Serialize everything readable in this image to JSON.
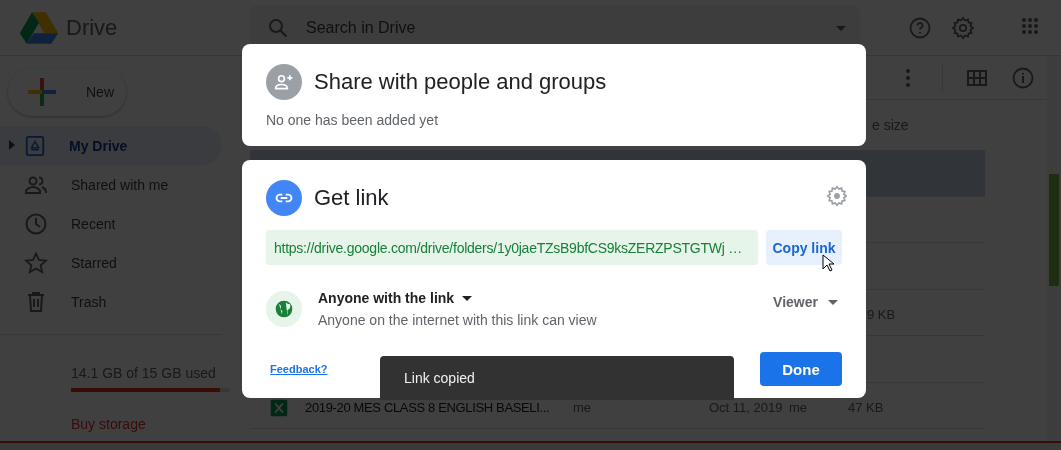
{
  "app": {
    "name": "Drive"
  },
  "search": {
    "placeholder": "Search in Drive"
  },
  "new_button": {
    "label": "New"
  },
  "sidebar": {
    "items": [
      {
        "kind": "my-drive",
        "label": "My Drive",
        "selected": true,
        "expanded": false
      },
      {
        "kind": "shared",
        "label": "Shared with me",
        "selected": false
      },
      {
        "kind": "recent",
        "label": "Recent",
        "selected": false
      },
      {
        "kind": "starred",
        "label": "Starred",
        "selected": false
      },
      {
        "kind": "trash",
        "label": "Trash",
        "selected": false
      }
    ]
  },
  "storage": {
    "usage": "14.1 GB of 15 GB used",
    "level": 0.94,
    "buy_label": "Buy storage"
  },
  "file_list": {
    "column_5": "e size",
    "rows": [
      {
        "selected": true
      },
      {
        "selected": false
      },
      {
        "selected": false
      },
      {
        "selected": false,
        "size": "9 KB"
      },
      {
        "selected": false
      },
      {
        "selected": false,
        "kind": "spreadsheet",
        "name": "2019-20 MES CLASS 8 ENGLISH BASELI...",
        "owner": "me",
        "modified": "Oct 11, 2019",
        "modified_by": "me",
        "size": "47 KB"
      }
    ]
  },
  "share_dialog": {
    "title": "Share with people and groups",
    "subtitle": "No one has been added yet"
  },
  "link_dialog": {
    "title": "Get link",
    "link": "https://drive.google.com/drive/folders/1y0jaeTZsB9bfCS9ksZERZPSTGTWj …",
    "copy_label": "Copy link",
    "access": {
      "label": "Anyone with the link",
      "description": "Anyone on the internet with this link can view"
    },
    "role": "Viewer",
    "feedback": "Feedback?",
    "done_label": "Done"
  },
  "toast": {
    "message": "Link copied"
  }
}
